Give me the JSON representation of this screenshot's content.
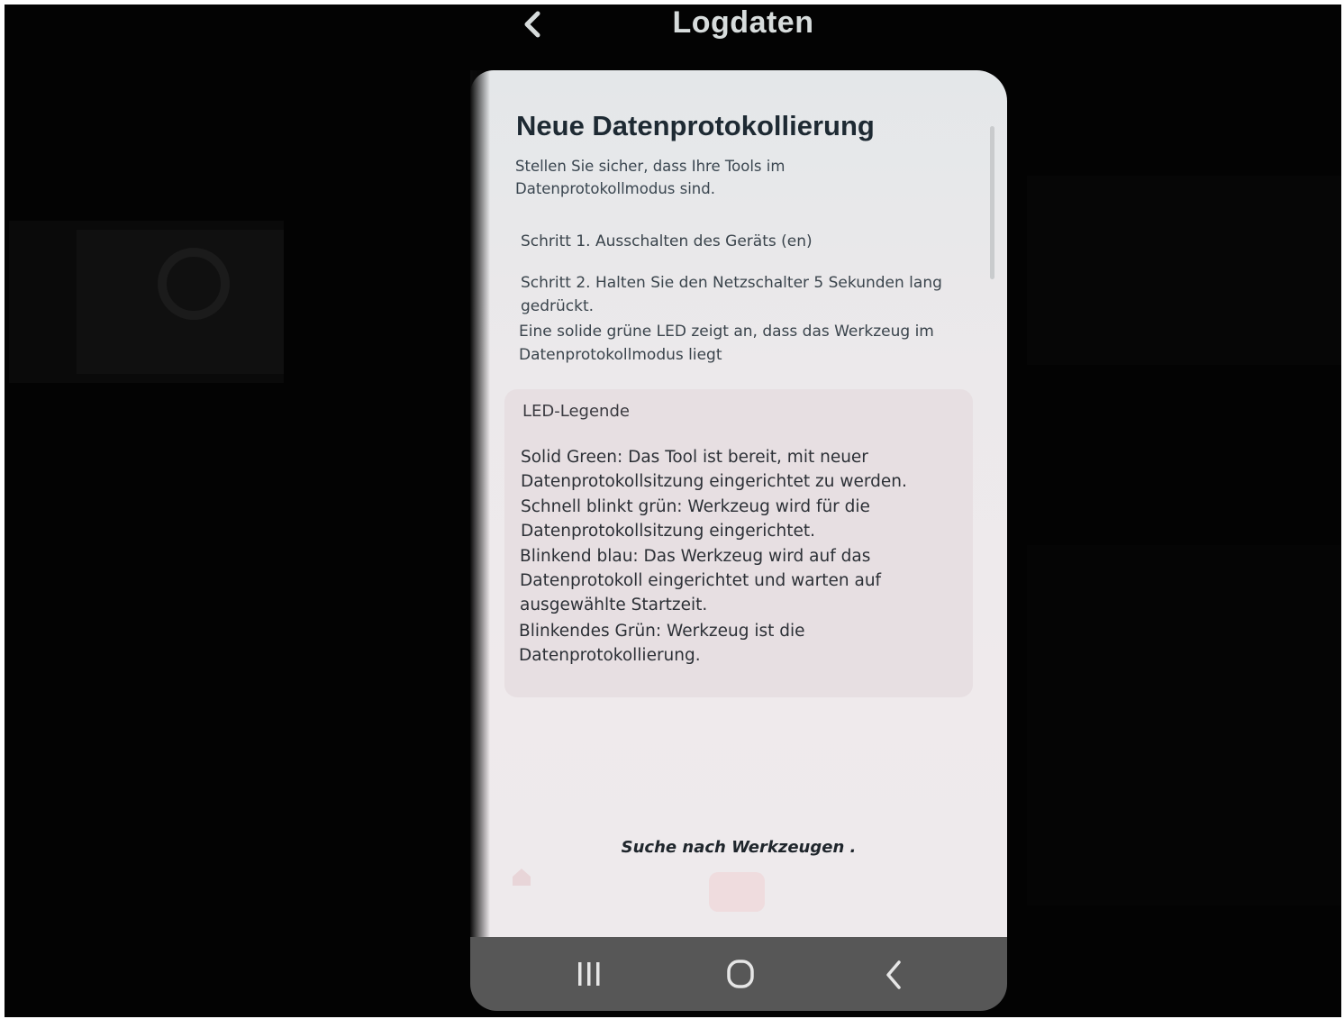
{
  "header": {
    "title": "Logdaten",
    "back_icon": "chevron-left-icon"
  },
  "page": {
    "title": "Neue Datenprotokollierung",
    "intro": "Stellen Sie sicher, dass Ihre Tools im Datenprotokollmodus sind.",
    "step1": "Schritt 1. Ausschalten des Geräts (en)",
    "step2": "Schritt 2. Halten Sie den Netzschalter 5 Sekunden lang gedrückt.",
    "step2_note": "Eine solide grüne LED zeigt an, dass das Werkzeug im Datenprotokollmodus liegt"
  },
  "legend": {
    "title": "LED-Legende",
    "items": [
      "Solid Green: Das Tool ist bereit, mit neuer Datenprotokollsitzung eingerichtet zu werden.",
      "Schnell blinkt grün: Werkzeug wird für die Datenprotokollsitzung eingerichtet.",
      "Blinkend blau: Das Werkzeug wird auf das Datenprotokoll eingerichtet und warten auf ausgewählte Startzeit.",
      "Blinkendes Grün: Werkzeug ist die Datenprotokollierung."
    ]
  },
  "status": {
    "searching": "Suche nach Werkzeugen ."
  },
  "navbar": {
    "icons": [
      "recents-icon",
      "home-icon",
      "back-icon"
    ]
  },
  "colors": {
    "screen_bg": "#ece9eb",
    "legend_bg": "#e7dfe2",
    "navbar_bg": "#575757",
    "title_text": "#1e2a33",
    "header_text": "#d7dcdc"
  }
}
